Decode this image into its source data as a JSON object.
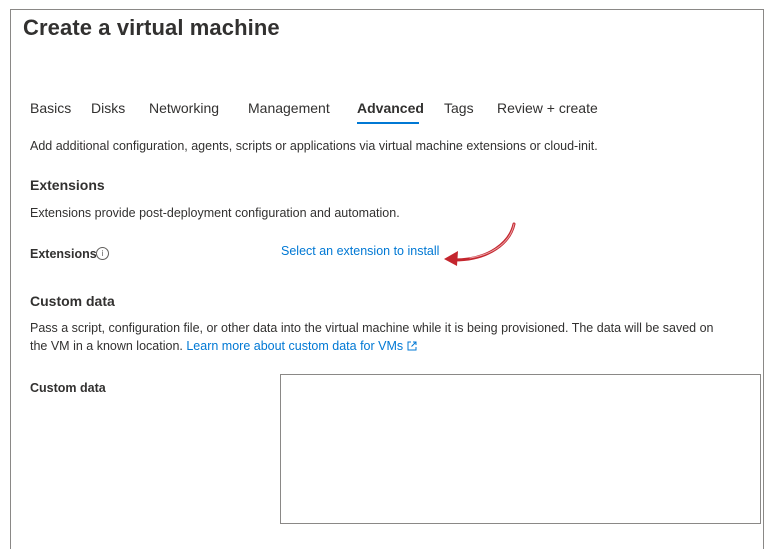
{
  "page": {
    "title": "Create a virtual machine"
  },
  "tabs": [
    {
      "label": "Basics"
    },
    {
      "label": "Disks"
    },
    {
      "label": "Networking"
    },
    {
      "label": "Management"
    },
    {
      "label": "Advanced",
      "active": true
    },
    {
      "label": "Tags"
    },
    {
      "label": "Review + create"
    }
  ],
  "intro": "Add additional configuration, agents, scripts or applications via virtual machine extensions or cloud-init.",
  "extensions": {
    "heading": "Extensions",
    "description": "Extensions provide post-deployment configuration and automation.",
    "field_label": "Extensions",
    "info_icon": "info-icon",
    "link": "Select an extension to install"
  },
  "custom_data": {
    "heading": "Custom data",
    "description_line1": "Pass a script, configuration file, or other data into the virtual machine while it is being provisioned. The data will be saved on",
    "description_line2": "the VM in a known location.",
    "learn_more": "Learn more about custom data for VMs",
    "field_label": "Custom data",
    "value": ""
  },
  "colors": {
    "accent": "#0078d4",
    "annotation_arrow": "#c4262e",
    "text": "#323130"
  }
}
